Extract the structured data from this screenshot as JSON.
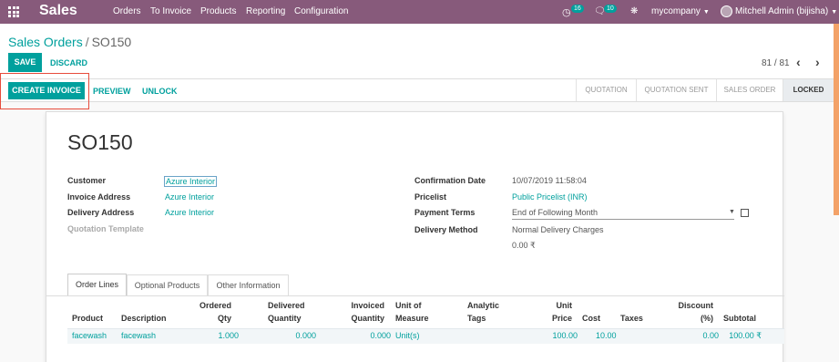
{
  "app": {
    "name": "Sales",
    "menu": [
      "Orders",
      "To Invoice",
      "Products",
      "Reporting",
      "Configuration"
    ],
    "activity_count": "16",
    "message_count": "10",
    "company": "mycompany",
    "user": "Mitchell Admin (bijisha)"
  },
  "breadcrumb": {
    "parent": "Sales Orders",
    "separator": "/",
    "current": "SO150"
  },
  "buttons": {
    "save": "SAVE",
    "discard": "DISCARD",
    "create_invoice": "CREATE INVOICE",
    "preview": "PREVIEW",
    "unlock": "UNLOCK"
  },
  "pager": {
    "text": "81 / 81"
  },
  "stages": [
    "QUOTATION",
    "QUOTATION SENT",
    "SALES ORDER",
    "LOCKED"
  ],
  "active_stage": "LOCKED",
  "order": {
    "name": "SO150",
    "left": {
      "customer_label": "Customer",
      "customer": "Azure Interior",
      "invoice_address_label": "Invoice Address",
      "invoice_address": "Azure Interior",
      "delivery_address_label": "Delivery Address",
      "delivery_address": "Azure Interior",
      "quotation_template_label": "Quotation Template"
    },
    "right": {
      "confirmation_date_label": "Confirmation Date",
      "confirmation_date": "10/07/2019 11:58:04",
      "pricelist_label": "Pricelist",
      "pricelist": "Public Pricelist (INR)",
      "payment_terms_label": "Payment Terms",
      "payment_terms": "End of Following Month",
      "delivery_method_label": "Delivery Method",
      "delivery_method": "Normal Delivery Charges",
      "delivery_amount": "0.00 ₹"
    }
  },
  "tabs": [
    "Order Lines",
    "Optional Products",
    "Other Information"
  ],
  "table": {
    "headers": {
      "product": "Product",
      "description": "Description",
      "ordered_1": "Ordered",
      "ordered_2": "Qty",
      "delivered_1": "Delivered",
      "delivered_2": "Quantity",
      "invoiced_1": "Invoiced",
      "invoiced_2": "Quantity",
      "uom_1": "Unit of",
      "uom_2": "Measure",
      "tags_1": "Analytic",
      "tags_2": "Tags",
      "price_1": "Unit",
      "price_2": "Price",
      "cost": "Cost",
      "taxes": "Taxes",
      "discount_1": "Discount",
      "discount_2": "(%)",
      "subtotal": "Subtotal"
    },
    "rows": [
      {
        "product": "facewash",
        "description": "facewash",
        "ordered": "1.000",
        "delivered": "0.000",
        "invoiced": "0.000",
        "uom": "Unit(s)",
        "price": "100.00",
        "cost": "10.00",
        "discount": "0.00",
        "subtotal": "100.00 ₹"
      }
    ]
  },
  "colors": {
    "navbar": "#875a7b",
    "accent": "#00a09d",
    "highlight_border": "#e74c3c"
  }
}
